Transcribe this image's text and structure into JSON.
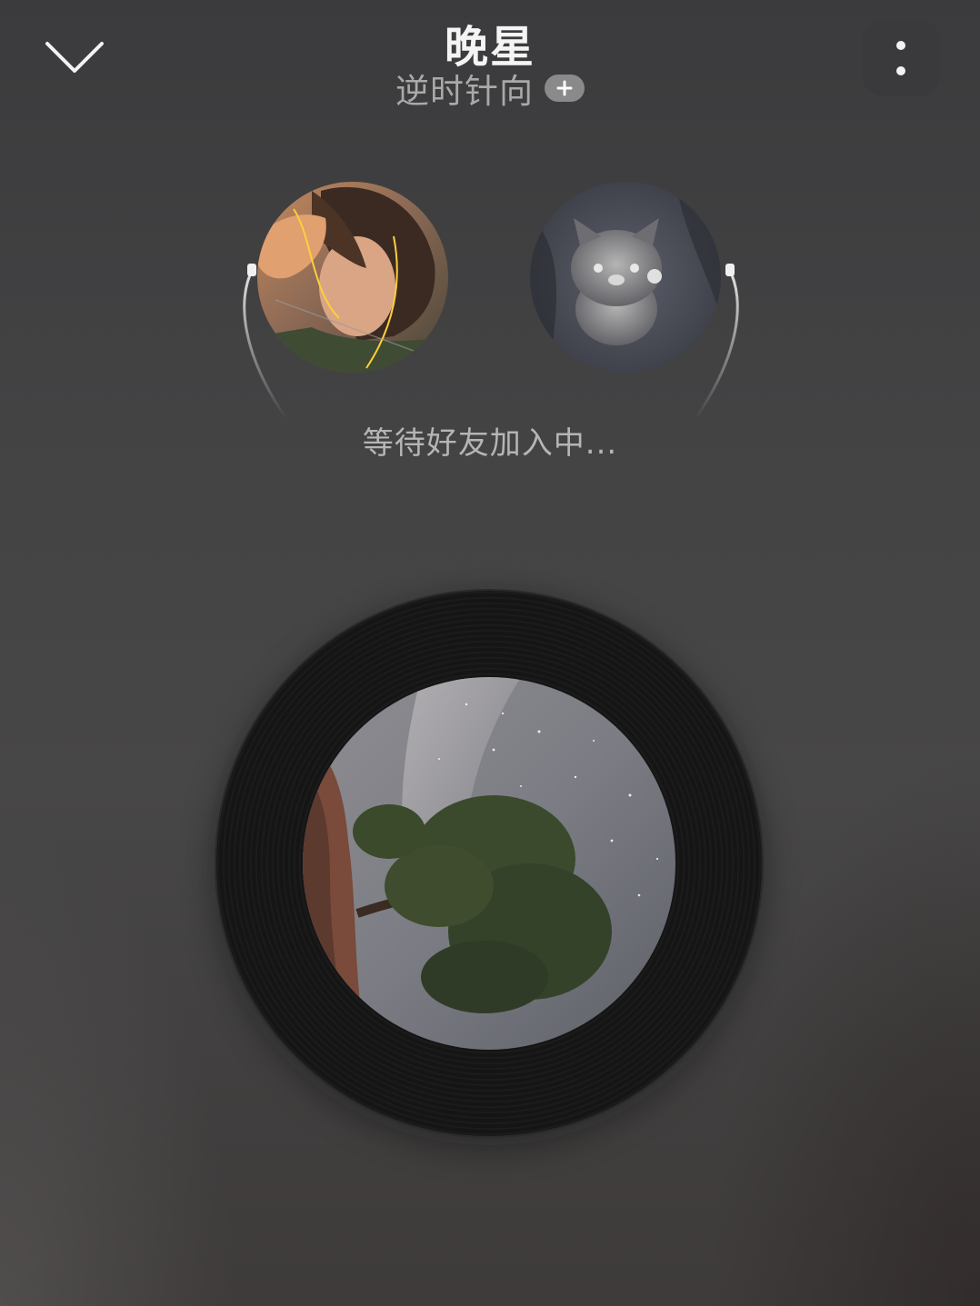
{
  "header": {
    "song_title": "晚星",
    "artist": "逆时针向",
    "follow_icon": "plus-icon",
    "collapse_icon": "chevron-down-icon",
    "more_icon": "more-vertical-icon"
  },
  "listen_together": {
    "status_text": "等待好友加入中...",
    "user_avatar": "person-photo-avatar",
    "friend_avatar": "kitten-photo-avatar"
  },
  "player": {
    "disc": "vinyl-record",
    "cover": "starry-sky-tree-cover"
  },
  "colors": {
    "background": "#434344",
    "title": "#f4f4f4",
    "subtitle": "#a9a9a9",
    "status": "#b5b5b5",
    "badge": "#8a8a8a"
  }
}
